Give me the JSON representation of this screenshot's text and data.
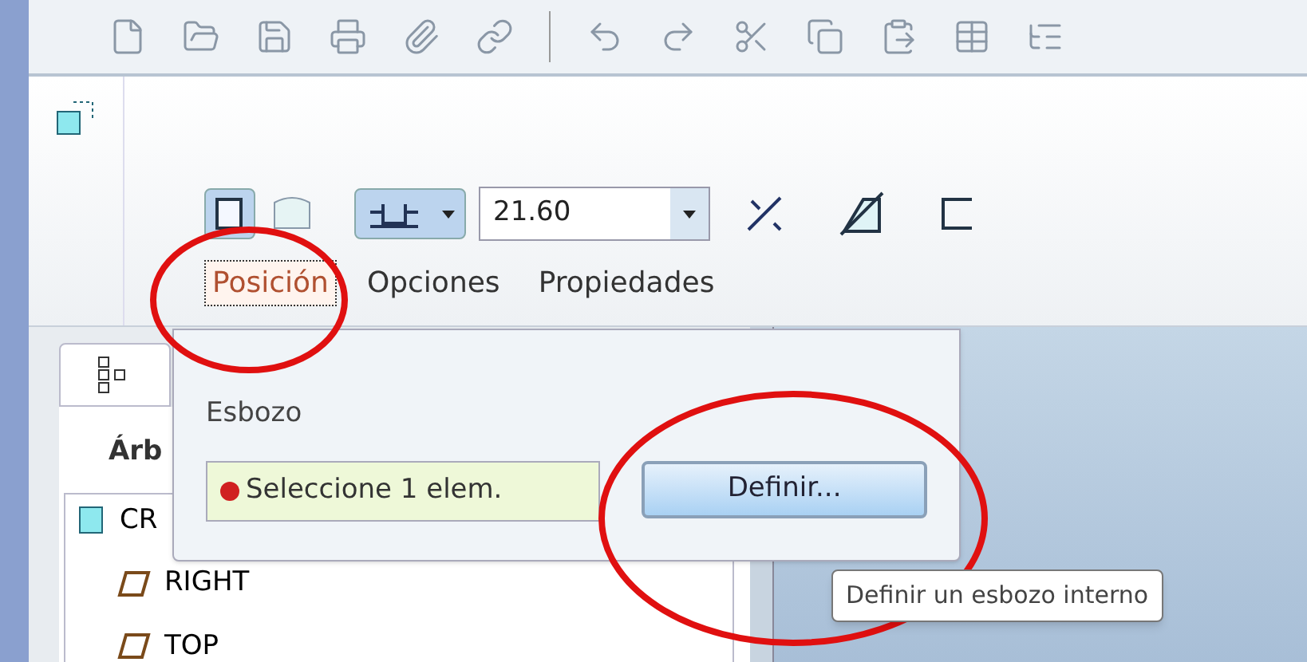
{
  "ribbon": {
    "field_value": "21.60",
    "tabs": [
      {
        "label": "Posición",
        "selected": true
      },
      {
        "label": "Opciones",
        "selected": false
      },
      {
        "label": "Propiedades",
        "selected": false
      }
    ]
  },
  "panel": {
    "section": "Esbozo",
    "collector": {
      "text": "Seleccione 1 elem.",
      "color": "#d02020"
    },
    "button": "Definir..."
  },
  "tooltip": "Definir un esbozo interno",
  "model_tree": {
    "title": "Árb",
    "items": [
      {
        "label": "CR",
        "kind": "part"
      },
      {
        "label": "RIGHT",
        "kind": "plane"
      },
      {
        "label": "TOP",
        "kind": "plane"
      }
    ]
  }
}
